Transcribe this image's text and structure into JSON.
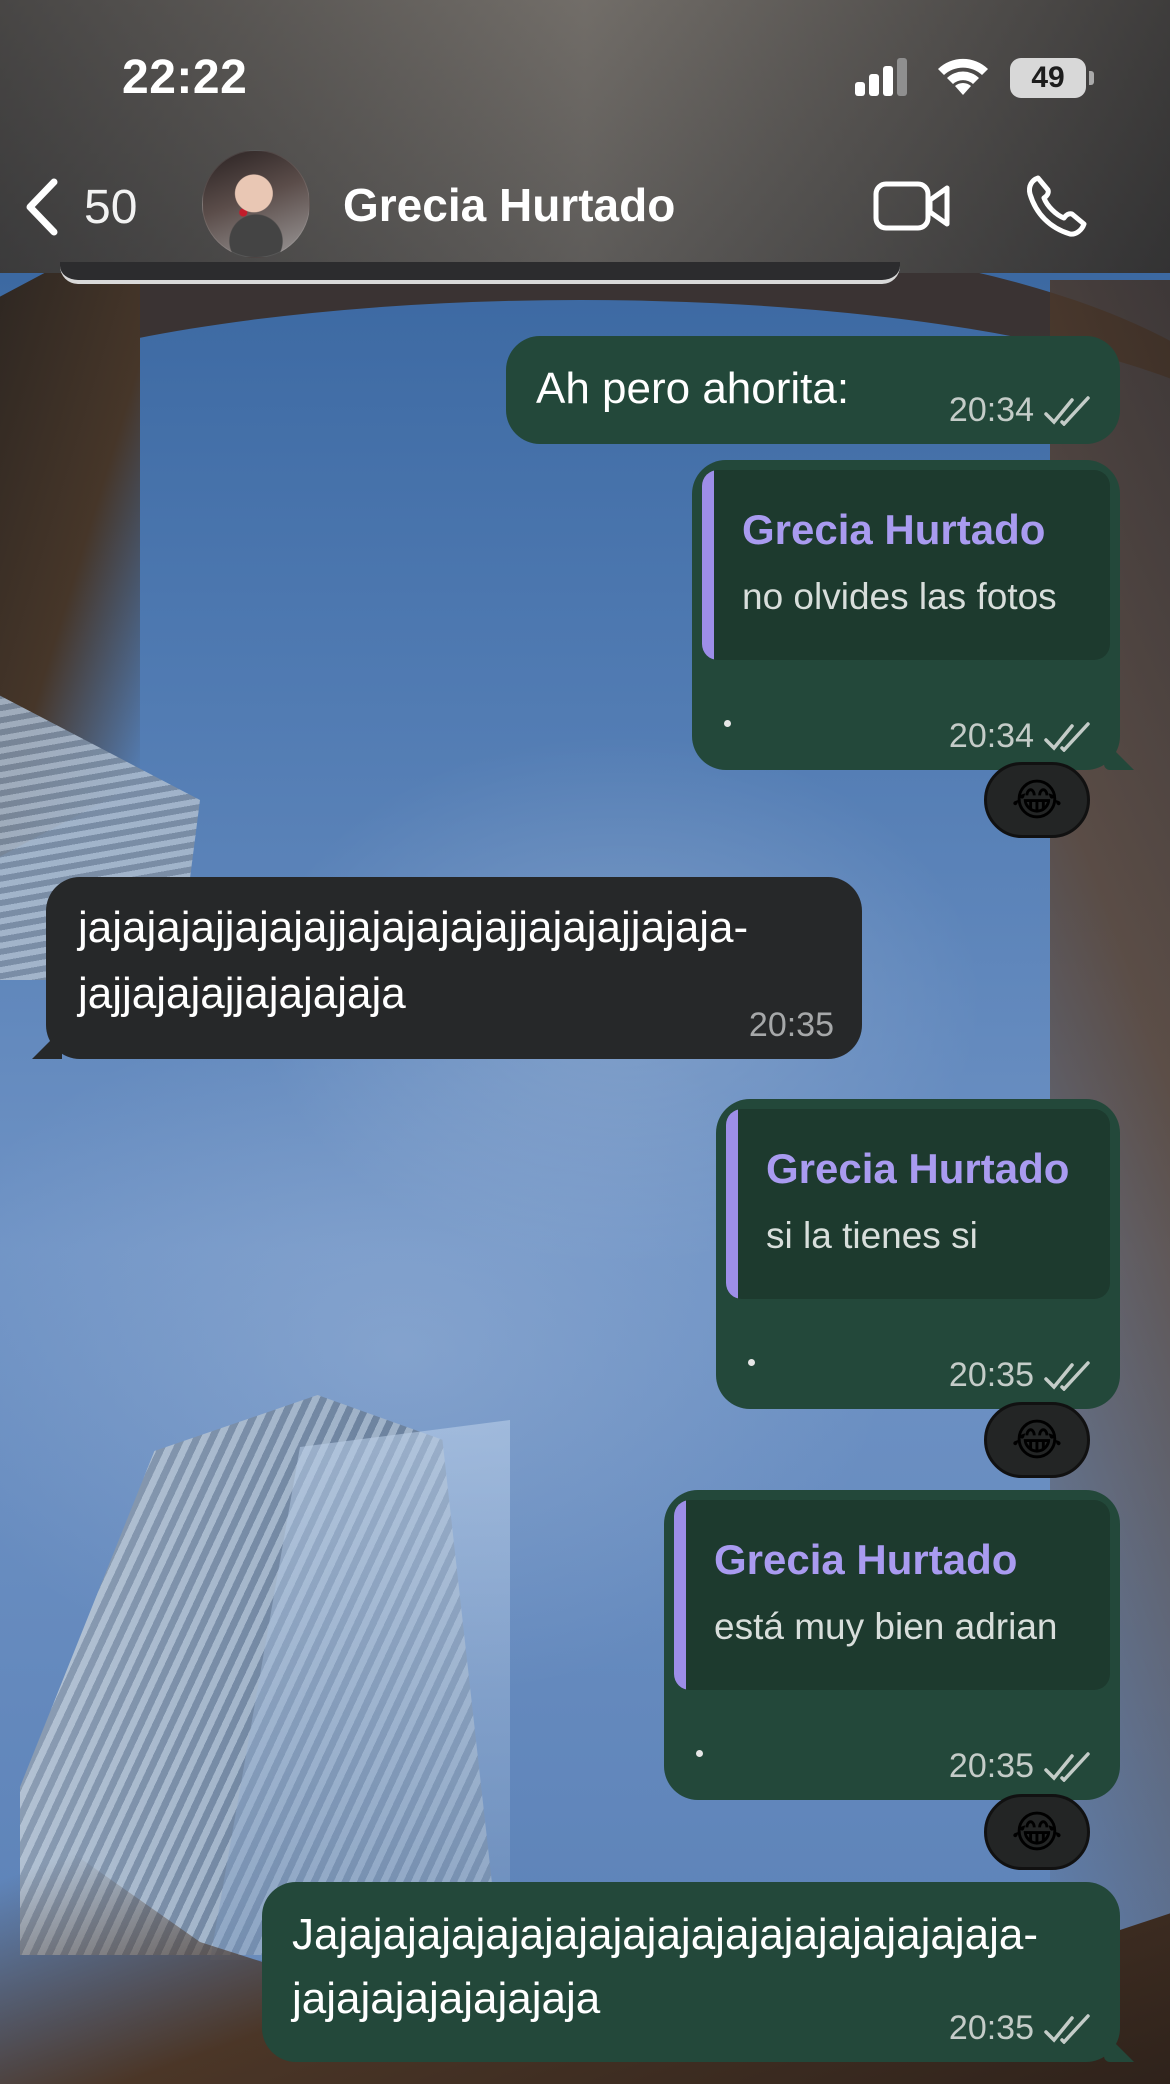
{
  "status_bar": {
    "time": "22:22",
    "battery": "49"
  },
  "header": {
    "back_count": "50",
    "contact_name": "Grecia Hurtado"
  },
  "messages": [
    {
      "direction": "out",
      "text": "Ah pero ahorita:",
      "time": "20:34"
    },
    {
      "direction": "out",
      "quote_name": "Grecia Hurtado",
      "quote_text": "no olvides las fotos",
      "time": "20:34",
      "reaction": "😂"
    },
    {
      "direction": "in",
      "text_line1": "jajajajajjajajajjajajajajajjajajajjajaja-",
      "text_line2": "jajjajajajjajajajaja",
      "time": "20:35"
    },
    {
      "direction": "out",
      "quote_name": "Grecia Hurtado",
      "quote_text": "si la tienes si",
      "time": "20:35",
      "reaction": "😂"
    },
    {
      "direction": "out",
      "quote_name": "Grecia Hurtado",
      "quote_text": "está muy bien adrian",
      "time": "20:35",
      "reaction": "😂"
    },
    {
      "direction": "out",
      "text_line1": "Jajajajajajajajajajajajajajajajajajajajaja-",
      "text_line2": "jajajajajajajajaja",
      "time": "20:35"
    }
  ],
  "colors": {
    "outgoing_bubble": "#23483a",
    "incoming_bubble": "#262829",
    "quote_accent": "#9d8ee8"
  },
  "icons": {
    "back": "chevron-left-icon",
    "video": "video-camera-icon",
    "phone": "phone-icon",
    "read_ticks": "double-check-icon"
  }
}
